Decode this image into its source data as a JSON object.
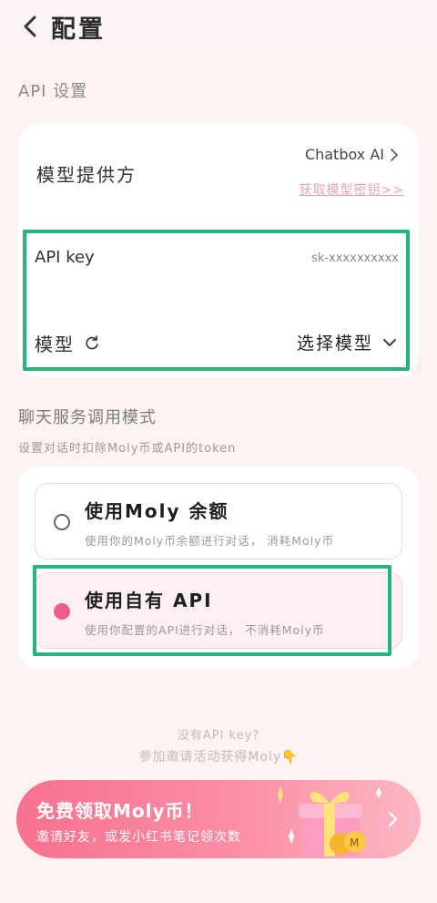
{
  "header": {
    "title": "配置"
  },
  "api_section": {
    "label": "API 设置",
    "provider_label": "模型提供方",
    "provider_value": "Chatbox AI",
    "get_key_link": "获取模型密钥>>",
    "api_key_label": "API key",
    "api_key_value": "sk-xxxxxxxxxx",
    "model_label": "模型",
    "model_select": "选择模型"
  },
  "mode_section": {
    "label": "聊天服务调用模式",
    "sublabel": "设置对话时扣除Moly币或API的token",
    "options": [
      {
        "title": "使用Moly 余额",
        "desc": "使用你的Moly币余额进行对话， 消耗Moly币",
        "selected": false
      },
      {
        "title": "使用自有 API",
        "desc": "使用你配置的API进行对话， 不消耗Moly币",
        "selected": true
      }
    ]
  },
  "hint": {
    "line1": "没有API key?",
    "line2": "参加邀请活动获得Moly👇"
  },
  "promo": {
    "title": "免费领取Moly币！",
    "subtitle": "邀请好友，或发小红书笔记领次数"
  },
  "colors": {
    "accent": "#ef5c8c",
    "highlight": "#24b57a",
    "link": "#e9a3b8",
    "background": "#fdf3f3"
  }
}
